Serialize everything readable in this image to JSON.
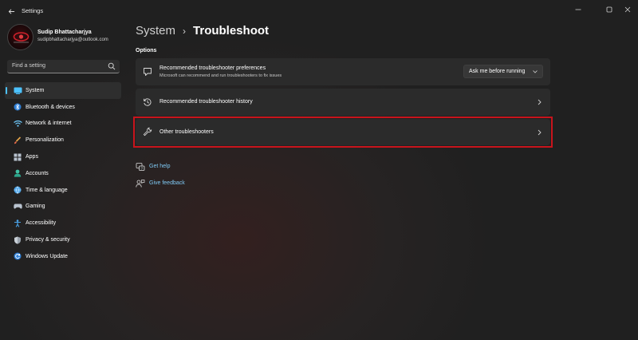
{
  "window": {
    "title": "Settings",
    "back_icon": "back-arrow-icon",
    "controls": [
      "minimize-icon",
      "maximize-icon",
      "close-icon"
    ]
  },
  "profile": {
    "name": "Sudip Bhattacharjya",
    "email": "sudipbhattacharjya@outlook.com"
  },
  "search": {
    "placeholder": "Find a setting"
  },
  "sidebar": {
    "items": [
      {
        "label": "System",
        "icon": "system-icon",
        "active": true
      },
      {
        "label": "Bluetooth & devices",
        "icon": "bluetooth-icon"
      },
      {
        "label": "Network & internet",
        "icon": "network-icon"
      },
      {
        "label": "Personalization",
        "icon": "brush-icon"
      },
      {
        "label": "Apps",
        "icon": "apps-icon"
      },
      {
        "label": "Accounts",
        "icon": "accounts-icon"
      },
      {
        "label": "Time & language",
        "icon": "globe-icon"
      },
      {
        "label": "Gaming",
        "icon": "gaming-icon"
      },
      {
        "label": "Accessibility",
        "icon": "accessibility-icon"
      },
      {
        "label": "Privacy & security",
        "icon": "shield-icon"
      },
      {
        "label": "Windows Update",
        "icon": "windows-update-icon"
      }
    ]
  },
  "breadcrumb": {
    "parent": "System",
    "separator": "›",
    "current": "Troubleshoot"
  },
  "main": {
    "section_title": "Options",
    "cards": [
      {
        "title": "Recommended troubleshooter preferences",
        "description": "Microsoft can recommend and run troubleshooters to fix issues",
        "dropdown_value": "Ask me before running"
      },
      {
        "title": "Recommended troubleshooter history"
      },
      {
        "title": "Other troubleshooters",
        "highlighted": true
      }
    ],
    "links": [
      {
        "label": "Get help",
        "icon": "help-icon"
      },
      {
        "label": "Give feedback",
        "icon": "feedback-icon"
      }
    ]
  },
  "colors": {
    "accent": "#4cc2ff",
    "highlight_border": "#c8141c",
    "link": "#7fc8f3",
    "card_bg": "#2b2b2b"
  }
}
